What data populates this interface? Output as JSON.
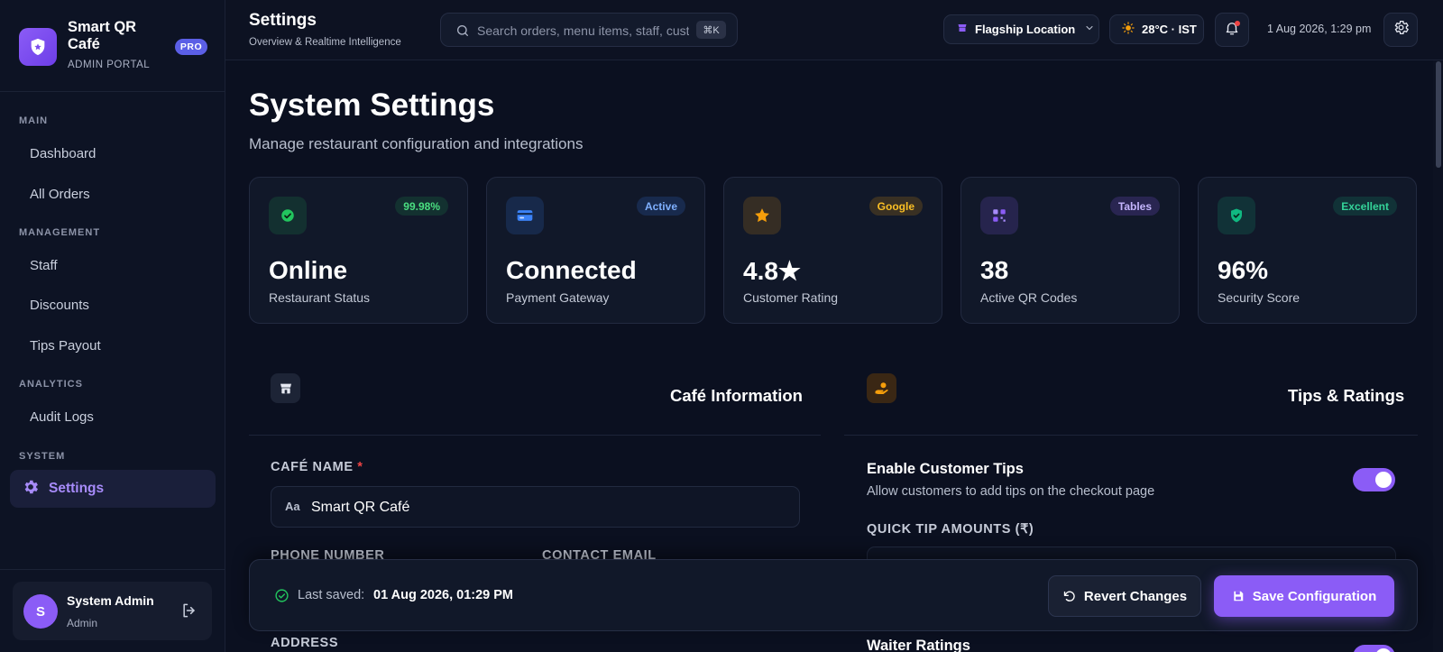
{
  "brand": {
    "name": "Smart QR Café",
    "subtitle": "ADMIN PORTAL",
    "badge": "PRO"
  },
  "sidebar": {
    "sections": [
      {
        "label": "MAIN",
        "items": [
          "Dashboard",
          "All Orders"
        ]
      },
      {
        "label": "MANAGEMENT",
        "items": [
          "Staff",
          "Discounts",
          "Tips Payout"
        ]
      },
      {
        "label": "ANALYTICS",
        "items": [
          "Audit Logs"
        ]
      },
      {
        "label": "SYSTEM",
        "items": [
          "Settings"
        ]
      }
    ],
    "active_item": "Settings"
  },
  "user": {
    "initial": "S",
    "name": "System Admin",
    "role": "Admin"
  },
  "header": {
    "title": "Settings",
    "subtitle": "Overview & Realtime Intelligence",
    "search_placeholder": "Search orders, menu items, staff, customers…",
    "search_shortcut": "⌘K",
    "location": "Flagship Location",
    "weather": "28°C · IST",
    "datetime": "1 Aug 2026, 1:29 pm"
  },
  "page": {
    "title": "System Settings",
    "subtitle": "Manage restaurant configuration and integrations"
  },
  "stats": [
    {
      "value": "Online",
      "label": "Restaurant Status",
      "badge": "99.98%",
      "icon": "check-circle-icon",
      "accent": "#22c55e"
    },
    {
      "value": "Connected",
      "label": "Payment Gateway",
      "badge": "Active",
      "icon": "credit-card-icon",
      "accent": "#3b82f6"
    },
    {
      "value": "4.8★",
      "label": "Customer Rating",
      "badge": "Google",
      "icon": "star-icon",
      "accent": "#f59e0b"
    },
    {
      "value": "38",
      "label": "Active QR Codes",
      "badge": "Tables",
      "icon": "qr-code-icon",
      "accent": "#8b5cf6"
    },
    {
      "value": "96%",
      "label": "Security Score",
      "badge": "Excellent",
      "icon": "shield-icon",
      "accent": "#10b981"
    }
  ],
  "cafe_info": {
    "title": "Café Information",
    "name_label": "CAFÉ NAME",
    "name_value": "Smart QR Café",
    "name_prefix": "Aa",
    "phone_label": "PHONE NUMBER",
    "email_label": "CONTACT EMAIL",
    "address_label": "ADDRESS"
  },
  "tips": {
    "title": "Tips & Ratings",
    "enable_title": "Enable Customer Tips",
    "enable_desc": "Allow customers to add tips on the checkout page",
    "quick_label": "QUICK TIP AMOUNTS (₹)",
    "waiter_title": "Waiter Ratings"
  },
  "save_bar": {
    "last_saved_label": "Last saved:",
    "last_saved_time": "01 Aug 2026, 01:29 PM",
    "revert_label": "Revert Changes",
    "save_label": "Save Configuration"
  },
  "colors": {
    "accent": "#8b5cf6",
    "background": "#0b1020",
    "card": "#111829"
  }
}
